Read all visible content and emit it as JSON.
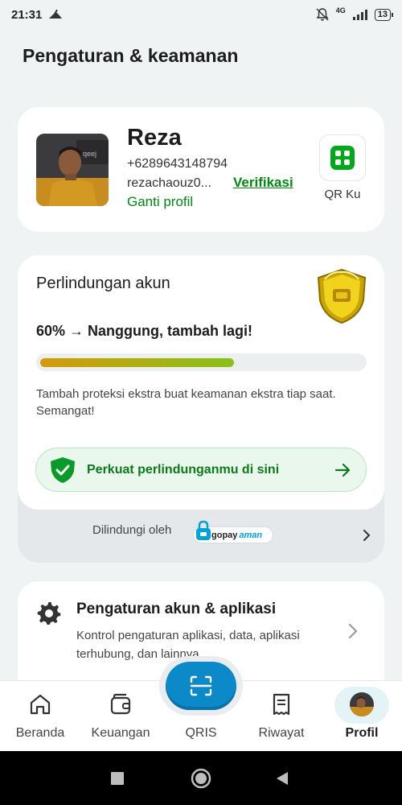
{
  "status_bar": {
    "time": "21:31",
    "network": "4G",
    "battery": "13"
  },
  "page": {
    "title": "Pengaturan & keamanan"
  },
  "profile": {
    "name": "Reza",
    "phone": "+6289643148794",
    "email": "rezachaouz0...",
    "verify_label": "Verifikasi",
    "edit_label": "Ganti profil",
    "qr_label": "QR Ku"
  },
  "protection": {
    "title": "Perlindungan akun",
    "progress_percent": 60,
    "progress_text": "60% → Nanggung, tambah lagi!",
    "description": "Tambah proteksi ekstra buat keamanan ekstra tiap saat. Semangat!",
    "cta_label": "Perkuat perlindunganmu di sini",
    "protected_by": "Dilindungi oleh",
    "gopay_brand": "gopay",
    "gopay_suffix": "aman"
  },
  "settings": {
    "title": "Pengaturan akun & aplikasi",
    "description": "Kontrol pengaturan aplikasi, data, aplikasi terhubung, dan lainnya."
  },
  "bottom_nav": {
    "items": [
      {
        "label": "Beranda",
        "icon": "home-icon"
      },
      {
        "label": "Keuangan",
        "icon": "wallet-icon"
      },
      {
        "label": "QRIS",
        "icon": "scan-icon"
      },
      {
        "label": "Riwayat",
        "icon": "receipt-icon"
      },
      {
        "label": "Profil",
        "icon": "avatar"
      }
    ],
    "active": "Profil"
  },
  "colors": {
    "brand_green": "#00880f",
    "accent_blue": "#0c89c9",
    "progress_start": "#d49a0c",
    "progress_end": "#88c218"
  }
}
